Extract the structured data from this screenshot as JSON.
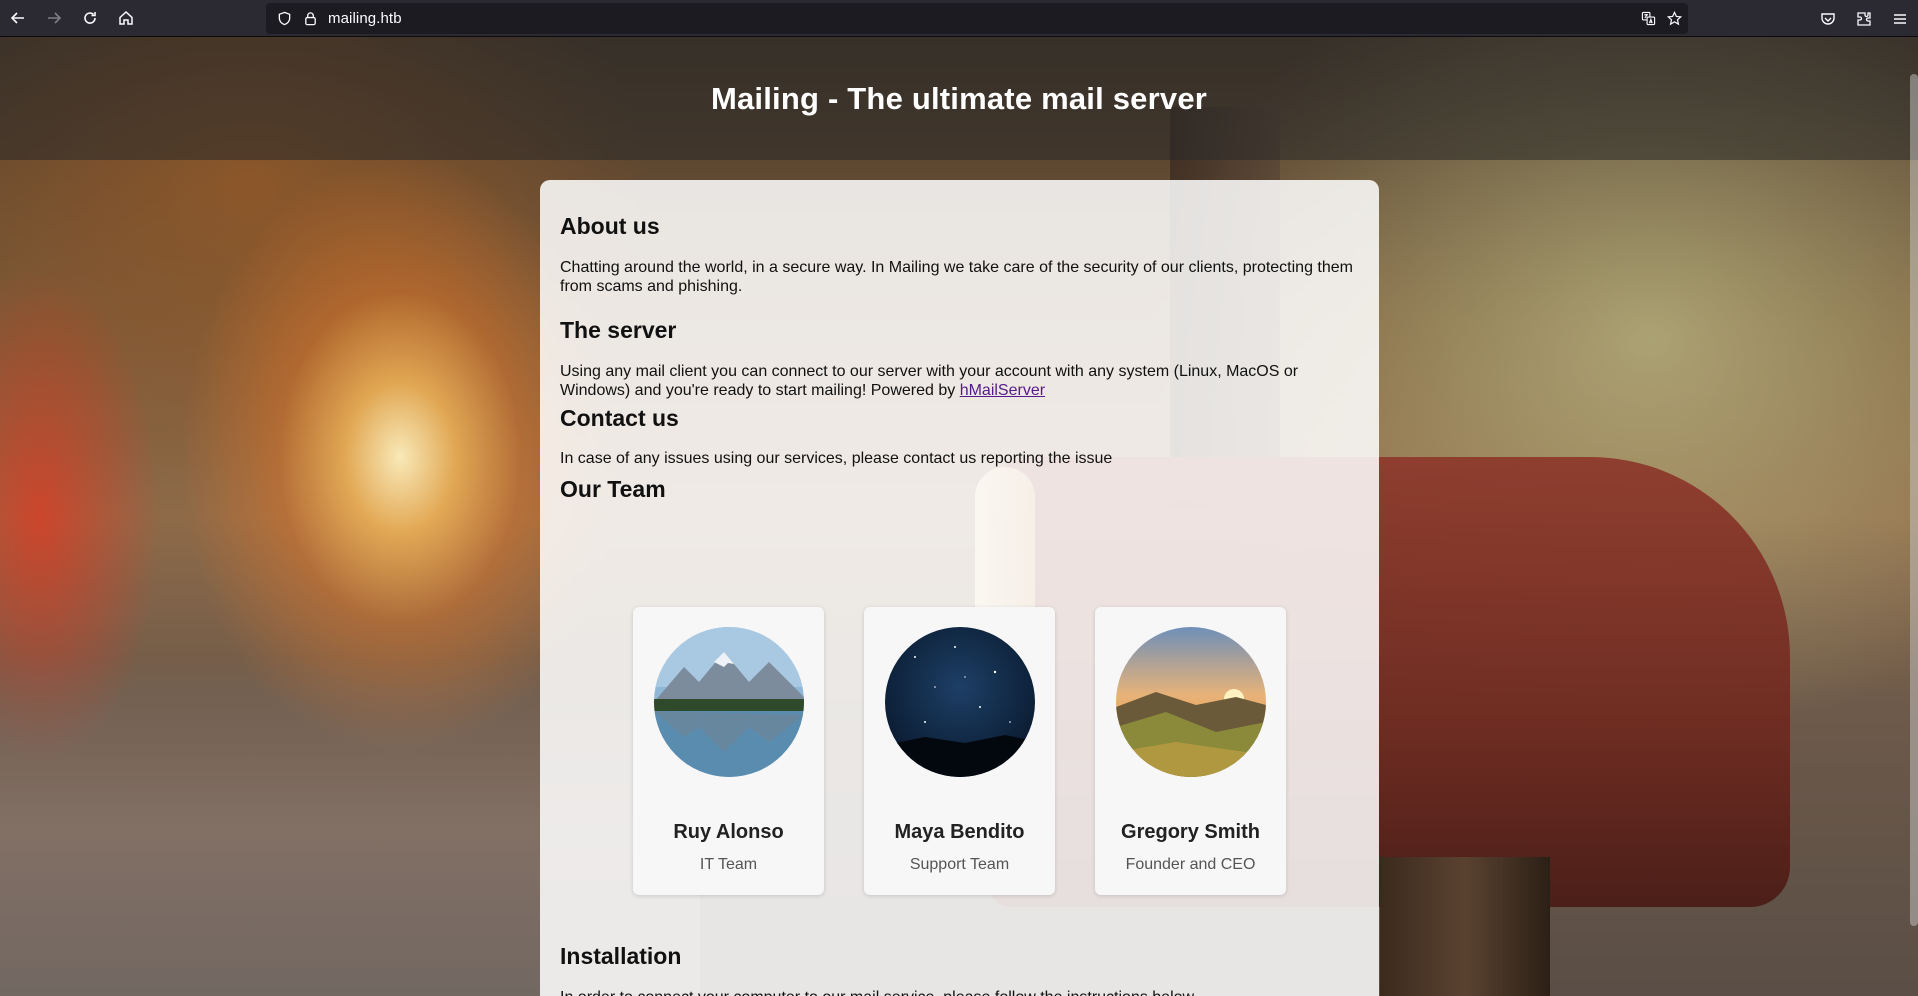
{
  "browser": {
    "url": "mailing.htb"
  },
  "page": {
    "hero_title": "Mailing - The ultimate mail server",
    "about": {
      "heading": "About us",
      "text": "Chatting around the world, in a secure way. In Mailing we take care of the security of our clients, protecting them from scams and phishing."
    },
    "server": {
      "heading": "The server",
      "text": "Using any mail client you can connect to our server with your account with any system (Linux, MacOS or Windows) and you're ready to start mailing! Powered by ",
      "link": "hMailServer"
    },
    "contact": {
      "heading": "Contact us",
      "text": "In case of any issues using our services, please contact us reporting the issue"
    },
    "team": {
      "heading": "Our Team",
      "members": [
        {
          "name": "Ruy Alonso",
          "role": "IT Team"
        },
        {
          "name": "Maya Bendito",
          "role": "Support Team"
        },
        {
          "name": "Gregory Smith",
          "role": "Founder and CEO"
        }
      ]
    },
    "installation": {
      "heading": "Installation",
      "text": "In order to connect your computer to our mail service, please follow the instructions below"
    }
  },
  "colors": {
    "link": "#551a8b",
    "toolbar": "#2b2a33",
    "urlbar": "#1c1b22"
  }
}
